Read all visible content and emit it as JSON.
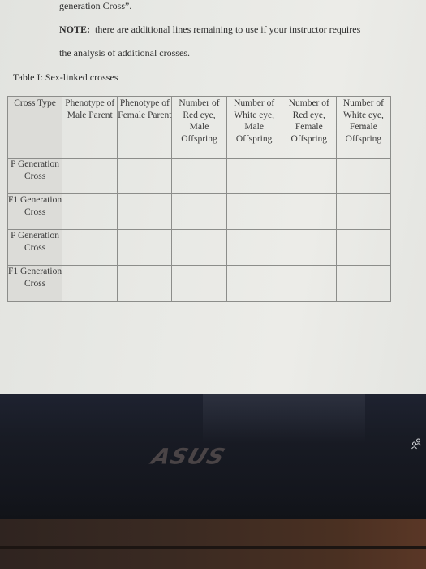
{
  "document": {
    "line1": "generation Cross”.",
    "note_label": "NOTE:",
    "note_text": "  there are additional lines remaining to use if your instructor requires",
    "line3": "the analysis of additional crosses.",
    "table_caption": "Table I: Sex-linked crosses"
  },
  "table": {
    "headers": [
      "Cross Type",
      "Phenotype of Male Parent",
      "Phenotype of Female Parent",
      "Number of Red eye, Male Offspring",
      "Number of White eye, Male Offspring",
      "Number of Red eye, Female Offspring",
      "Number of White eye, Female Offspring"
    ],
    "rows": [
      {
        "label": "P Generation Cross",
        "cells": [
          "",
          "",
          "",
          "",
          "",
          ""
        ]
      },
      {
        "label": "F1 Generation Cross",
        "cells": [
          "",
          "",
          "",
          "",
          "",
          ""
        ]
      },
      {
        "label": "P Generation Cross",
        "cells": [
          "",
          "",
          "",
          "",
          "",
          ""
        ]
      },
      {
        "label": "F1 Generation Cross",
        "cells": [
          "",
          "",
          "",
          "",
          "",
          ""
        ]
      }
    ]
  },
  "device": {
    "brand_logo": "ASUS",
    "tray_icon": "people-icon"
  }
}
